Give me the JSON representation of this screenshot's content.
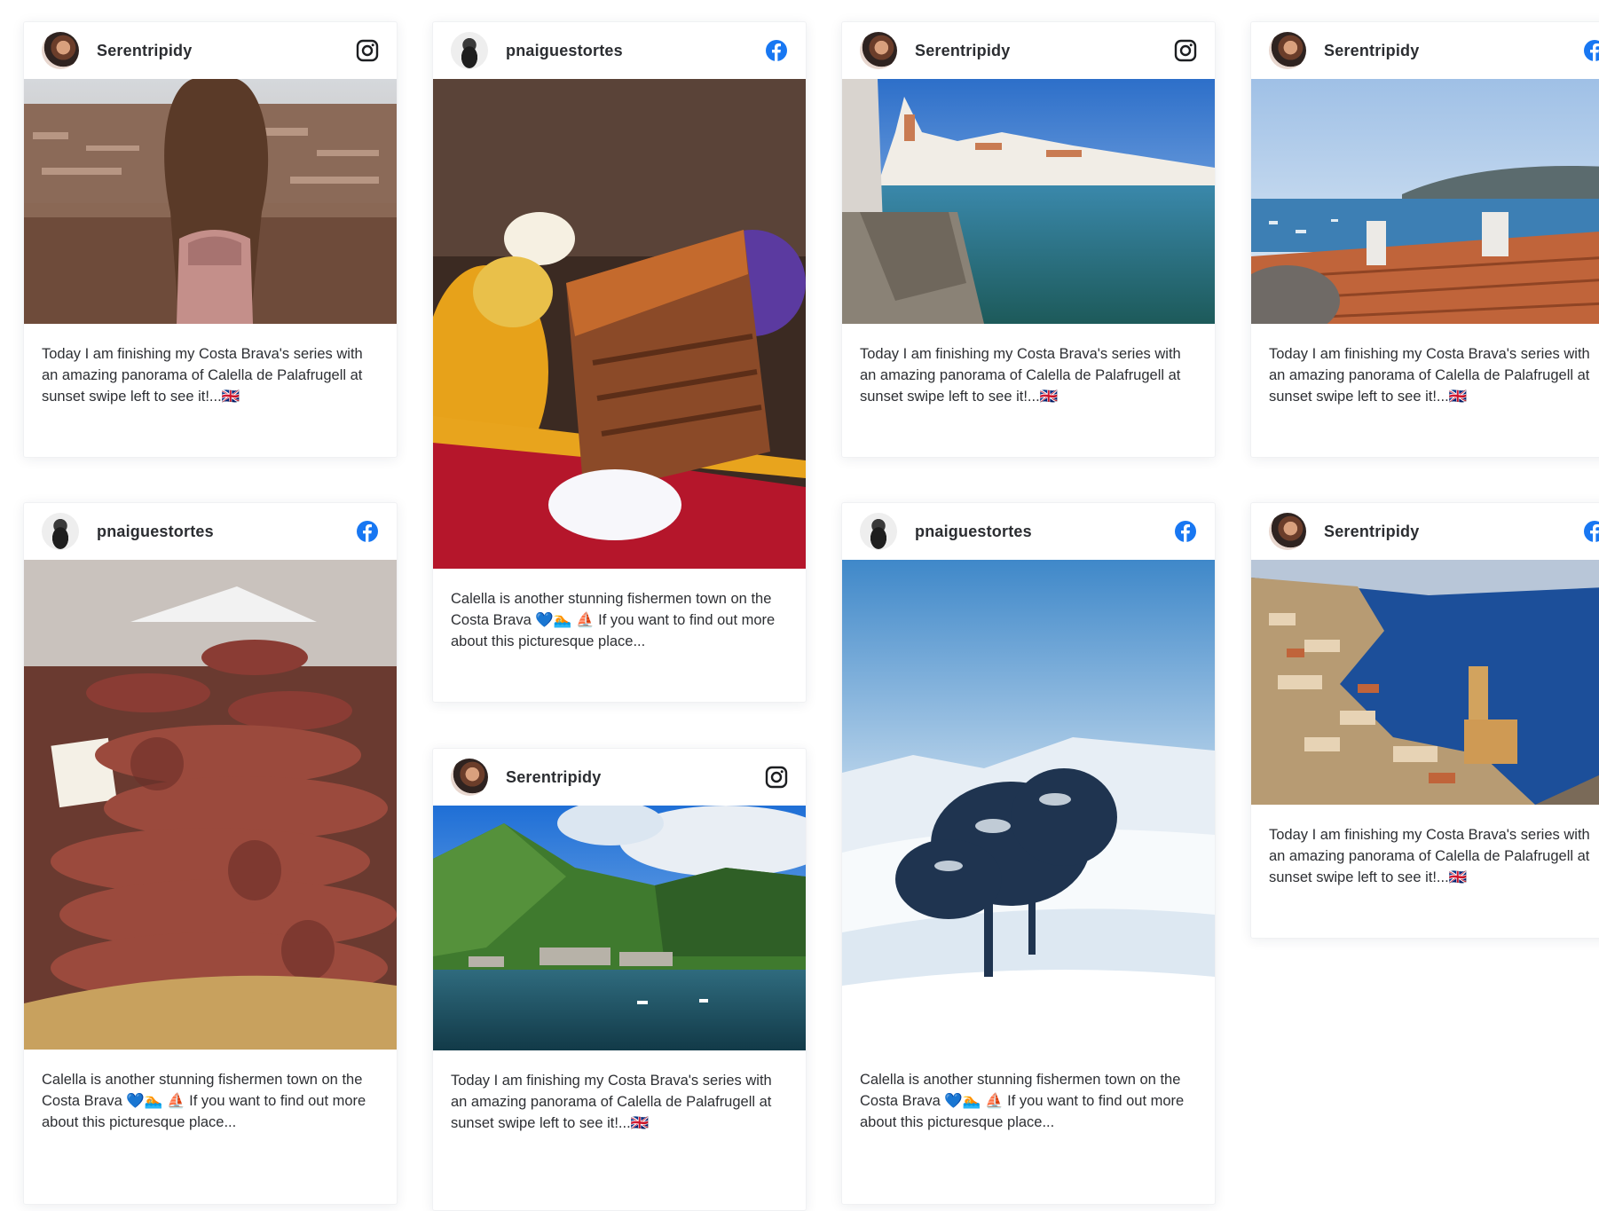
{
  "feed": {
    "cards": [
      {
        "author": "Serentripidy",
        "network": "instagram-icon",
        "photo": "woman-overlooking-town",
        "caption": "Today I am finishing my Costa Brava's series with an amazing panorama of Calella de Palafrugell at sunset swipe left to see it!...🇬🇧"
      },
      {
        "author": "pnaiguestortes",
        "network": "facebook-icon",
        "photo": "grilled-meat-dish",
        "caption": "Calella is another stunning fishermen town on the Costa Brava 💙🏊 ⛵ If you want to find out more about this picturesque place..."
      },
      {
        "author": "Serentripidy",
        "network": "instagram-icon",
        "photo": "coastal-town-harbor",
        "caption": "Today I am finishing my Costa Brava's series with an amazing panorama of Calella de Palafrugell at sunset swipe left to see it!...🇬🇧"
      },
      {
        "author": "Serentripidy",
        "network": "facebook-icon",
        "photo": "rooftops-and-bay",
        "caption": "Today I am finishing my Costa Brava's series with an amazing panorama of Calella de Palafrugell at sunset swipe left to see it!...🇬🇧"
      },
      {
        "author": "pnaiguestortes",
        "network": "facebook-icon",
        "photo": "sausages-market",
        "caption": "Calella is another stunning fishermen town on the Costa Brava 💙🏊 ⛵ If you want to find out more about this picturesque place..."
      },
      {
        "author": "Serentripidy",
        "network": "instagram-icon",
        "photo": "mountain-lake",
        "caption": "Today I am finishing my Costa Brava's series with an amazing panorama of Calella de Palafrugell at sunset swipe left to see it!...🇬🇧"
      },
      {
        "author": "pnaiguestortes",
        "network": "facebook-icon",
        "photo": "snowy-tree",
        "caption": "Calella is another stunning fishermen town on the Costa Brava 💙🏊 ⛵ If you want to find out more about this picturesque place..."
      },
      {
        "author": "Serentripidy",
        "network": "facebook-icon",
        "photo": "aerial-coastal-town",
        "caption": "Today I am finishing my Costa Brava's series with an amazing panorama of Calella de Palafrugell at sunset swipe left to see it!...🇬🇧"
      }
    ]
  },
  "colors": {
    "facebook": "#1877f2",
    "instagram": "#1c1e21",
    "card_border": "#f0f1f3"
  }
}
